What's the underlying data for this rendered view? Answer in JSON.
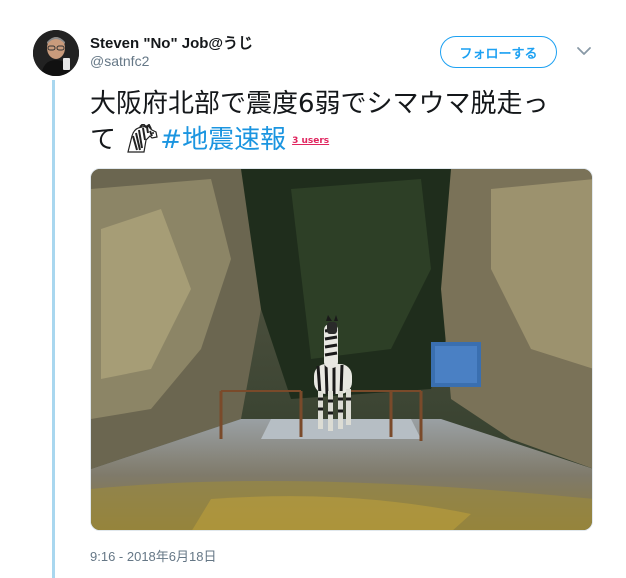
{
  "tweet": {
    "author_name": "Steven \"No\" Job@うじ",
    "author_handle": "@satnfc2",
    "follow_label": "フォローする",
    "text_line1": "大阪府北部で震度6弱でシマウマ脱走っ",
    "text_line2_prefix": "て",
    "emoji": "zebra-emoji",
    "hashtag": "#地震速報",
    "users_badge": "3 users",
    "timestamp": "9:16 - 2018年6月18日"
  },
  "icons": {
    "menu": "chevron-down-icon",
    "avatar": "avatar-photo"
  },
  "colors": {
    "accent": "#1da1f2",
    "hashtag": "#1b95e0",
    "thread_line": "#a9d7ef",
    "badge": "#e0245e",
    "secondary_text": "#657786"
  }
}
